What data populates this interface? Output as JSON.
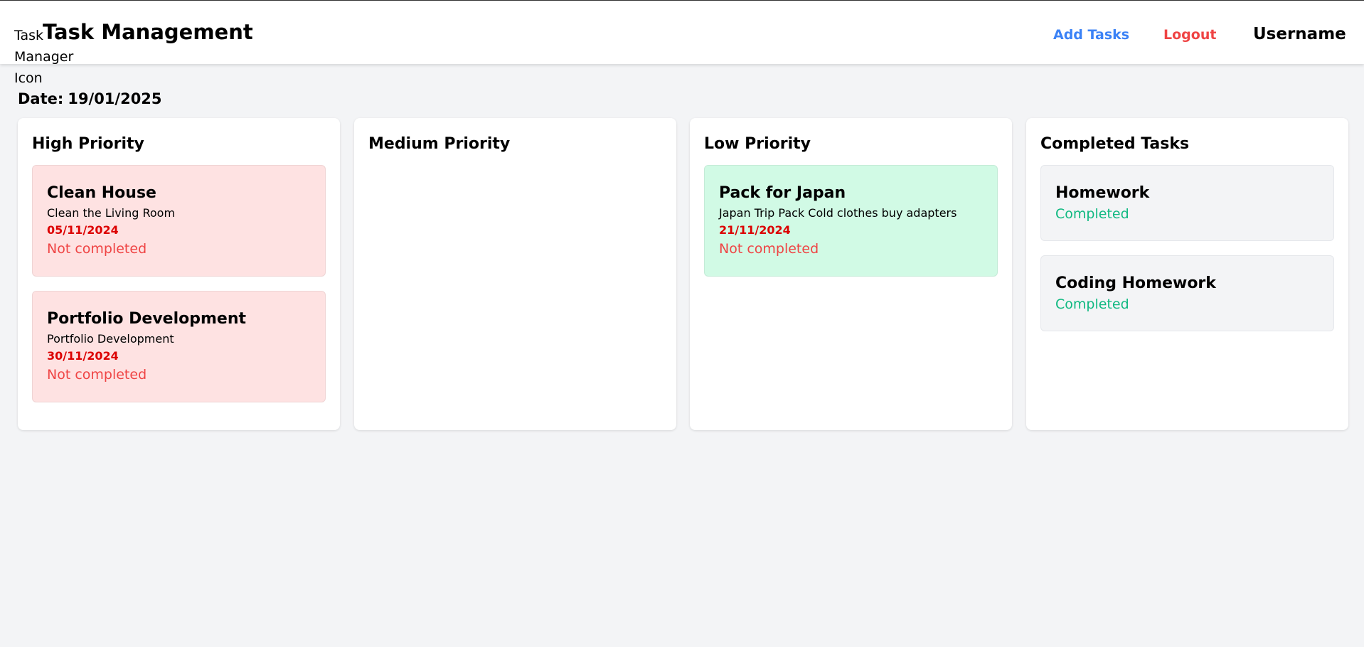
{
  "header": {
    "logo_alt": "Task Manager Icon",
    "title": "Task Management",
    "nav": {
      "add_tasks": "Add Tasks",
      "logout": "Logout",
      "username": "Username"
    }
  },
  "date": {
    "label": "Date:",
    "value": "19/01/2025"
  },
  "columns": {
    "high": {
      "title": "High Priority",
      "tasks": [
        {
          "title": "Clean House",
          "description": "Clean the Living Room",
          "due": "05/11/2024",
          "status": "Not completed"
        },
        {
          "title": "Portfolio Development",
          "description": "Portfolio Development",
          "due": "30/11/2024",
          "status": "Not completed"
        }
      ]
    },
    "medium": {
      "title": "Medium Priority",
      "tasks": []
    },
    "low": {
      "title": "Low Priority",
      "tasks": [
        {
          "title": "Pack for Japan",
          "description": "Japan Trip Pack Cold clothes buy adapters",
          "due": "21/11/2024",
          "status": "Not completed"
        }
      ]
    },
    "completed": {
      "title": "Completed Tasks",
      "tasks": [
        {
          "title": "Homework",
          "status": "Completed"
        },
        {
          "title": "Coding Homework",
          "status": "Completed"
        }
      ]
    }
  },
  "colors": {
    "high_card": "#fee2e2",
    "low_card": "#d1fae5",
    "completed_card": "#f3f4f6",
    "add_link": "#3b82f6",
    "logout_link": "#ef4444",
    "due_date": "#dc0000",
    "status_completed": "#10b981",
    "status_not_completed": "#ef4444"
  }
}
